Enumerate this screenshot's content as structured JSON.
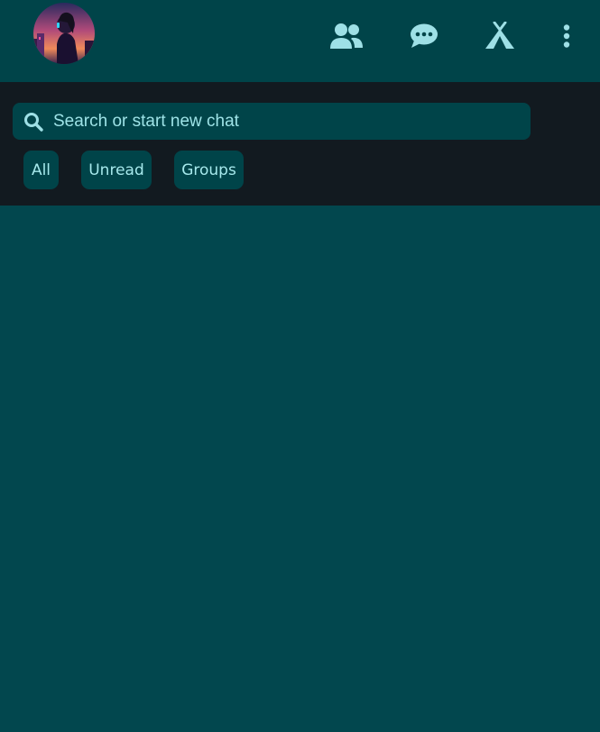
{
  "header": {
    "avatar": "profile-avatar",
    "icons": {
      "contacts": "people-icon",
      "chats": "chat-bubble-icon",
      "communities": "community-tent-icon",
      "menu": "kebab-menu-icon"
    }
  },
  "search": {
    "placeholder": "Search or start new chat",
    "value": "",
    "icon": "search-icon"
  },
  "filters": {
    "all": "All",
    "unread": "Unread",
    "groups": "Groups"
  },
  "colors": {
    "accent": "#a6e9ec",
    "header_bg": "#004449",
    "toolbar_bg": "#121a20",
    "content_bg": "#02474e"
  }
}
